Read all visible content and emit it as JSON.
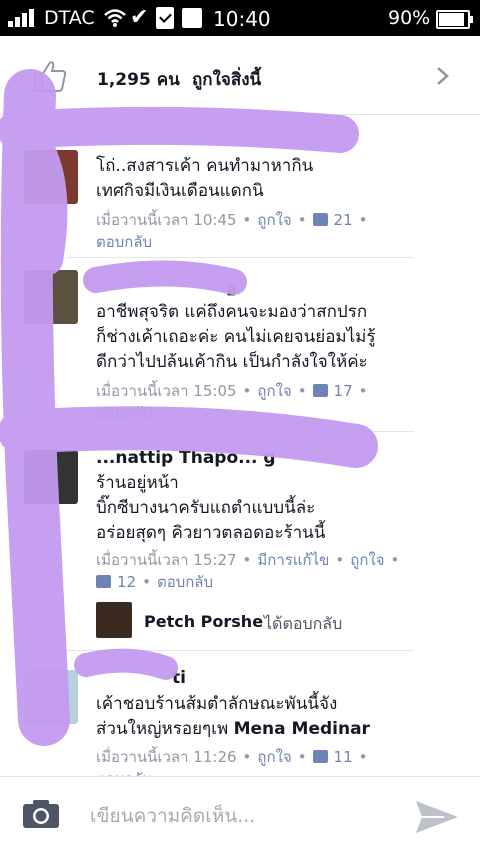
{
  "status_bar": {
    "carrier": "DTAC",
    "time": "10:40",
    "battery": "90%"
  },
  "header": {
    "likes_count": "1,295 คน",
    "likes_text": "ถูกใจสิ่งนี้"
  },
  "comments": [
    {
      "name": "",
      "body": "โถ่..สงสารเค้า คนทำมาหากิน\nเทศกิจมีเงินเดือนแดกนิ",
      "time": "เมื่อวานนี้เวลา 10:45",
      "like": "ถูกใจ",
      "like_count": "21",
      "reply": "ตอบกลับ"
    },
    {
      "name": "อ",
      "body": "อาชีพสุจริต แค่ถึงคนจะมองว่าสกปรก\nก็ช่างเค้าเถอะค่ะ คนไม่เคยจนย่อมไม่รู้\nดีกว่าไปปล้นเค้ากิน เป็นกำลังใจให้ค่ะ",
      "time": "เมื่อวานนี้เวลา 15:05",
      "like": "ถูกใจ",
      "like_count": "17",
      "reply": "ตอบกลับ"
    },
    {
      "name": "...nattip Thapo... g",
      "body": "ร้านอยู่หน้า\nบิ๊กซีบางนาครับแถตำแบบนี้ล่ะ\nอร่อยสุดๆ คิวยาวตลอดอะร้านนี้",
      "time": "เมื่อวานนี้เวลา 15:27",
      "edited": "มีการแก้ไข",
      "like": "ถูกใจ",
      "like_count": "12",
      "reply": "ตอบกลับ",
      "reply_by": {
        "name": "Petch Porshe",
        "verb": "ได้ตอบกลับ"
      }
    },
    {
      "name": "ti",
      "body_prefix": "เค้าชอบร้านส้มตำลักษณะพันนี้จัง\nส่วนใหญ่หรอยๆเพ ",
      "body_tag": "Mena Medinar",
      "time": "เมื่อวานนี้เวลา 11:26",
      "like": "ถูกใจ",
      "like_count": "11",
      "reply": "ตอบกลับ"
    }
  ],
  "composer": {
    "placeholder": "เขียนความคิดเห็น..."
  },
  "colors": {
    "link": "#6d84b4",
    "meta": "#9197a3",
    "scribble": "#c39af0"
  }
}
